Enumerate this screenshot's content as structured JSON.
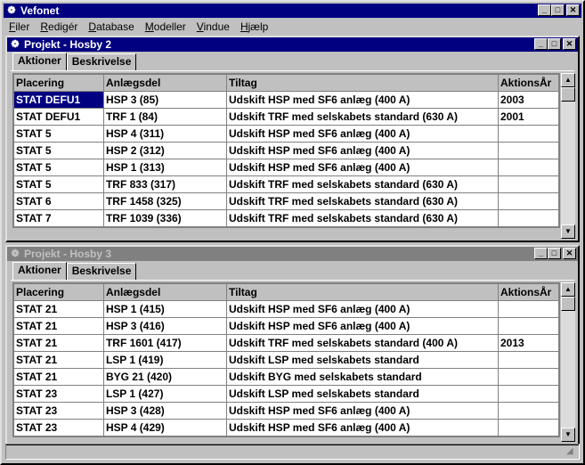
{
  "app": {
    "title": "Vefonet",
    "menu": [
      "Filer",
      "Redigér",
      "Database",
      "Modeller",
      "Vindue",
      "Hjælp"
    ],
    "menu_mnemonics": [
      "F",
      "R",
      "D",
      "M",
      "V",
      "H"
    ]
  },
  "windows": [
    {
      "title": "Projekt - Hosby 2",
      "active": true,
      "tabs": [
        "Aktioner",
        "Beskrivelse"
      ],
      "columns": [
        "Placering",
        "Anlægsdel",
        "Tiltag",
        "AktionsÅr"
      ],
      "rows": [
        [
          "STAT DEFU1",
          "HSP 3 (85)",
          "Udskift HSP med SF6 anlæg (400 A)",
          "2003"
        ],
        [
          "STAT DEFU1",
          "TRF 1 (84)",
          "Udskift TRF med selskabets standard (630 A)",
          "2001"
        ],
        [
          "STAT 5",
          "HSP 4 (311)",
          "Udskift HSP med SF6 anlæg (400 A)",
          ""
        ],
        [
          "STAT 5",
          "HSP 2 (312)",
          "Udskift HSP med SF6 anlæg (400 A)",
          ""
        ],
        [
          "STAT 5",
          "HSP 1 (313)",
          "Udskift HSP med SF6 anlæg (400 A)",
          ""
        ],
        [
          "STAT 5",
          "TRF 833 (317)",
          "Udskift TRF med selskabets standard (630 A)",
          ""
        ],
        [
          "STAT 6",
          "TRF 1458 (325)",
          "Udskift TRF med selskabets standard (630 A)",
          ""
        ],
        [
          "STAT 7",
          "TRF 1039 (336)",
          "Udskift TRF med selskabets standard (630 A)",
          ""
        ]
      ]
    },
    {
      "title": "Projekt - Hosby 3",
      "active": false,
      "tabs": [
        "Aktioner",
        "Beskrivelse"
      ],
      "columns": [
        "Placering",
        "Anlægsdel",
        "Tiltag",
        "AktionsÅr"
      ],
      "rows": [
        [
          "STAT 21",
          "HSP 1 (415)",
          "Udskift HSP med SF6 anlæg (400 A)",
          ""
        ],
        [
          "STAT 21",
          "HSP 3 (416)",
          "Udskift HSP med SF6 anlæg (400 A)",
          ""
        ],
        [
          "STAT 21",
          "TRF 1601 (417)",
          "Udskift TRF med selskabets standard (400 A)",
          "2013"
        ],
        [
          "STAT 21",
          "LSP 1 (419)",
          "Udskift LSP med selskabets standard",
          ""
        ],
        [
          "STAT 21",
          "BYG 21 (420)",
          "Udskift BYG med selskabets standard",
          ""
        ],
        [
          "STAT 23",
          "LSP 1 (427)",
          "Udskift LSP med selskabets standard",
          ""
        ],
        [
          "STAT 23",
          "HSP 3 (428)",
          "Udskift HSP med SF6 anlæg (400 A)",
          ""
        ],
        [
          "STAT 23",
          "HSP 4 (429)",
          "Udskift HSP med SF6 anlæg (400 A)",
          ""
        ]
      ]
    }
  ],
  "colors": {
    "title_active": "#000080",
    "title_inactive": "#808080",
    "face": "#c0c0c0",
    "selection": "#000080"
  },
  "icons": [
    "app-icon",
    "minimize-icon",
    "maximize-icon",
    "close-icon",
    "scroll-up-icon",
    "scroll-down-icon",
    "resize-grip-icon"
  ]
}
